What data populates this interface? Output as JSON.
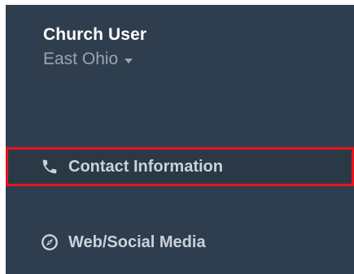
{
  "user": {
    "name": "Church User",
    "organization": "East Ohio"
  },
  "icons": {
    "contact": "phone-icon",
    "web": "compass-icon",
    "org_toggle": "caret-down-icon"
  },
  "nav": {
    "items": [
      {
        "label": "Contact Information",
        "active": true
      },
      {
        "label": "Web/Social Media",
        "active": false
      }
    ]
  },
  "colors": {
    "sidebar_bg": "#2f3e4e",
    "active_outline": "#e8141c",
    "text_primary": "#ffffff",
    "text_muted": "#9aa5b1",
    "nav_text": "#c9d2db"
  }
}
